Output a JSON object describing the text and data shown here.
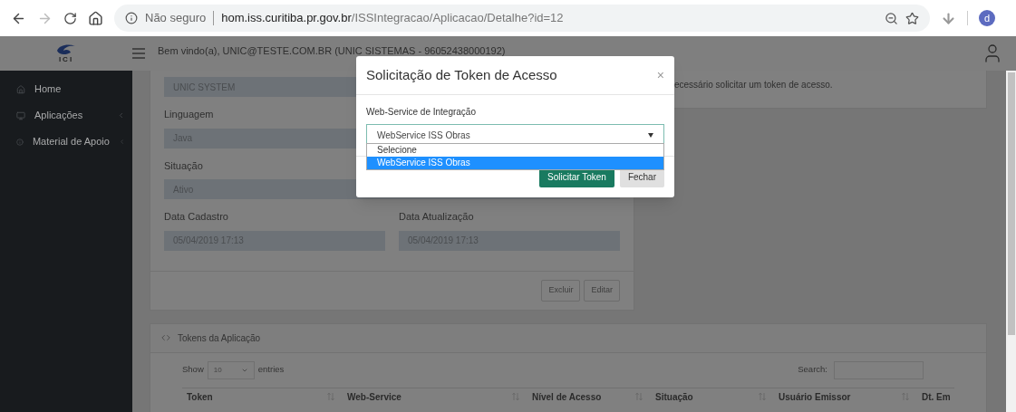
{
  "browser": {
    "security": "Não seguro",
    "url_host": "hom.iss.curitiba.pr.gov.br",
    "url_path": "/ISSIntegracao/Aplicacao/Detalhe?id=12",
    "avatar": "d"
  },
  "logo": {
    "text": "ICI"
  },
  "header": {
    "welcome": "Bem vindo(a), UNIC@TESTE.COM.BR (UNIC SISTEMAS - 96052438000192)"
  },
  "sidebar": {
    "items": [
      {
        "label": "Home",
        "kind": "home",
        "submenu": false
      },
      {
        "label": "Aplicações",
        "kind": "window",
        "submenu": true
      },
      {
        "label": "Material de Apoio",
        "kind": "info",
        "submenu": true
      }
    ]
  },
  "details": {
    "fields": [
      {
        "value": "UNIC SYSTEM"
      },
      {
        "label": "Linguagem",
        "value": "Java"
      },
      {
        "label": "Situação",
        "value": "Ativo"
      }
    ],
    "date_fields": [
      {
        "label": "Data Cadastro",
        "value": "05/04/2019 17:13"
      },
      {
        "label": "Data Atualização",
        "value": "05/04/2019 17:13"
      }
    ],
    "buttons": [
      "Excluir",
      "Editar"
    ]
  },
  "notice": "ecessário solicitar um token de acesso.",
  "tokens": {
    "title": "Tokens da Aplicação",
    "show_label": "Show",
    "page_size": "10",
    "entries_label": "entries",
    "search_label": "Search:",
    "columns": [
      "Token",
      "Web-Service",
      "Nível de Acesso",
      "Situação",
      "Usuário Emissor",
      "Dt. Em"
    ]
  },
  "modal": {
    "title": "Solicitação de Token de Acesso",
    "close": "×",
    "field_label": "Web-Service de Integração",
    "select_value": "WebService ISS Obras",
    "options": [
      {
        "label": "Selecione",
        "selected": false
      },
      {
        "label": "WebService ISS Obras",
        "selected": true
      }
    ],
    "buttons": [
      {
        "label": "Solicitar Token",
        "kind": "primary"
      },
      {
        "label": "Fechar",
        "kind": "secondary"
      }
    ]
  }
}
